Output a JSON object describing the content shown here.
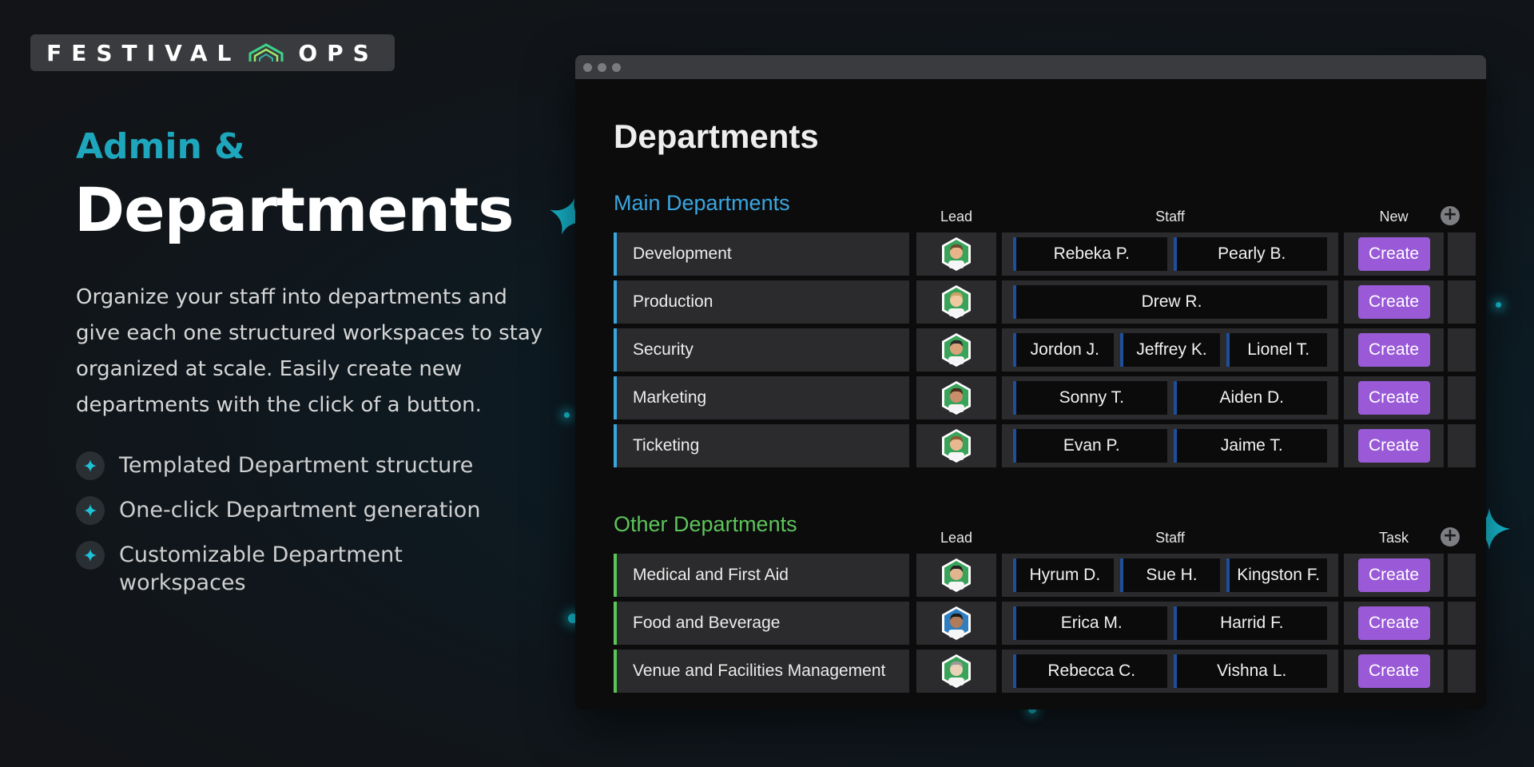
{
  "brand": {
    "left": "FESTIVAL",
    "right": "OPS",
    "accent": "#3cd48a"
  },
  "hero": {
    "eyebrow": "Admin &",
    "title": "Departments",
    "paragraph": "Organize your staff into departments and give each one structured workspaces to stay organized at scale. Easily create new departments with the click of a button.",
    "features": [
      "Templated Department structure",
      "One-click Department generation",
      "Customizable Department workspaces"
    ]
  },
  "app": {
    "page_title": "Departments",
    "main": {
      "title": "Main Departments",
      "color": "#3aa6e0",
      "columns": {
        "lead": "Lead",
        "staff": "Staff",
        "action": "New"
      },
      "rows": [
        {
          "name": "Development",
          "staff": [
            "Rebeka P.",
            "Pearly B."
          ],
          "action": "Create"
        },
        {
          "name": "Production",
          "staff": [
            "Drew R."
          ],
          "action": "Create"
        },
        {
          "name": "Security",
          "staff": [
            "Jordon J.",
            "Jeffrey K.",
            "Lionel T."
          ],
          "action": "Create"
        },
        {
          "name": "Marketing",
          "staff": [
            "Sonny T.",
            "Aiden D."
          ],
          "action": "Create"
        },
        {
          "name": "Ticketing",
          "staff": [
            "Evan P.",
            "Jaime T."
          ],
          "action": "Create"
        }
      ]
    },
    "other": {
      "title": "Other Departments",
      "color": "#5dc45a",
      "columns": {
        "lead": "Lead",
        "staff": "Staff",
        "action": "Task"
      },
      "rows": [
        {
          "name": "Medical and First Aid",
          "staff": [
            "Hyrum D.",
            "Sue H.",
            "Kingston F."
          ],
          "action": "Create"
        },
        {
          "name": "Food and Beverage",
          "staff": [
            "Erica M.",
            "Harrid F."
          ],
          "action": "Create"
        },
        {
          "name": "Venue and Facilities Management",
          "staff": [
            "Rebecca C.",
            "Vishna L."
          ],
          "action": "Create"
        }
      ]
    },
    "colors": {
      "button": "#9a5ad8",
      "chip_accent": "#1d4f9a"
    }
  }
}
